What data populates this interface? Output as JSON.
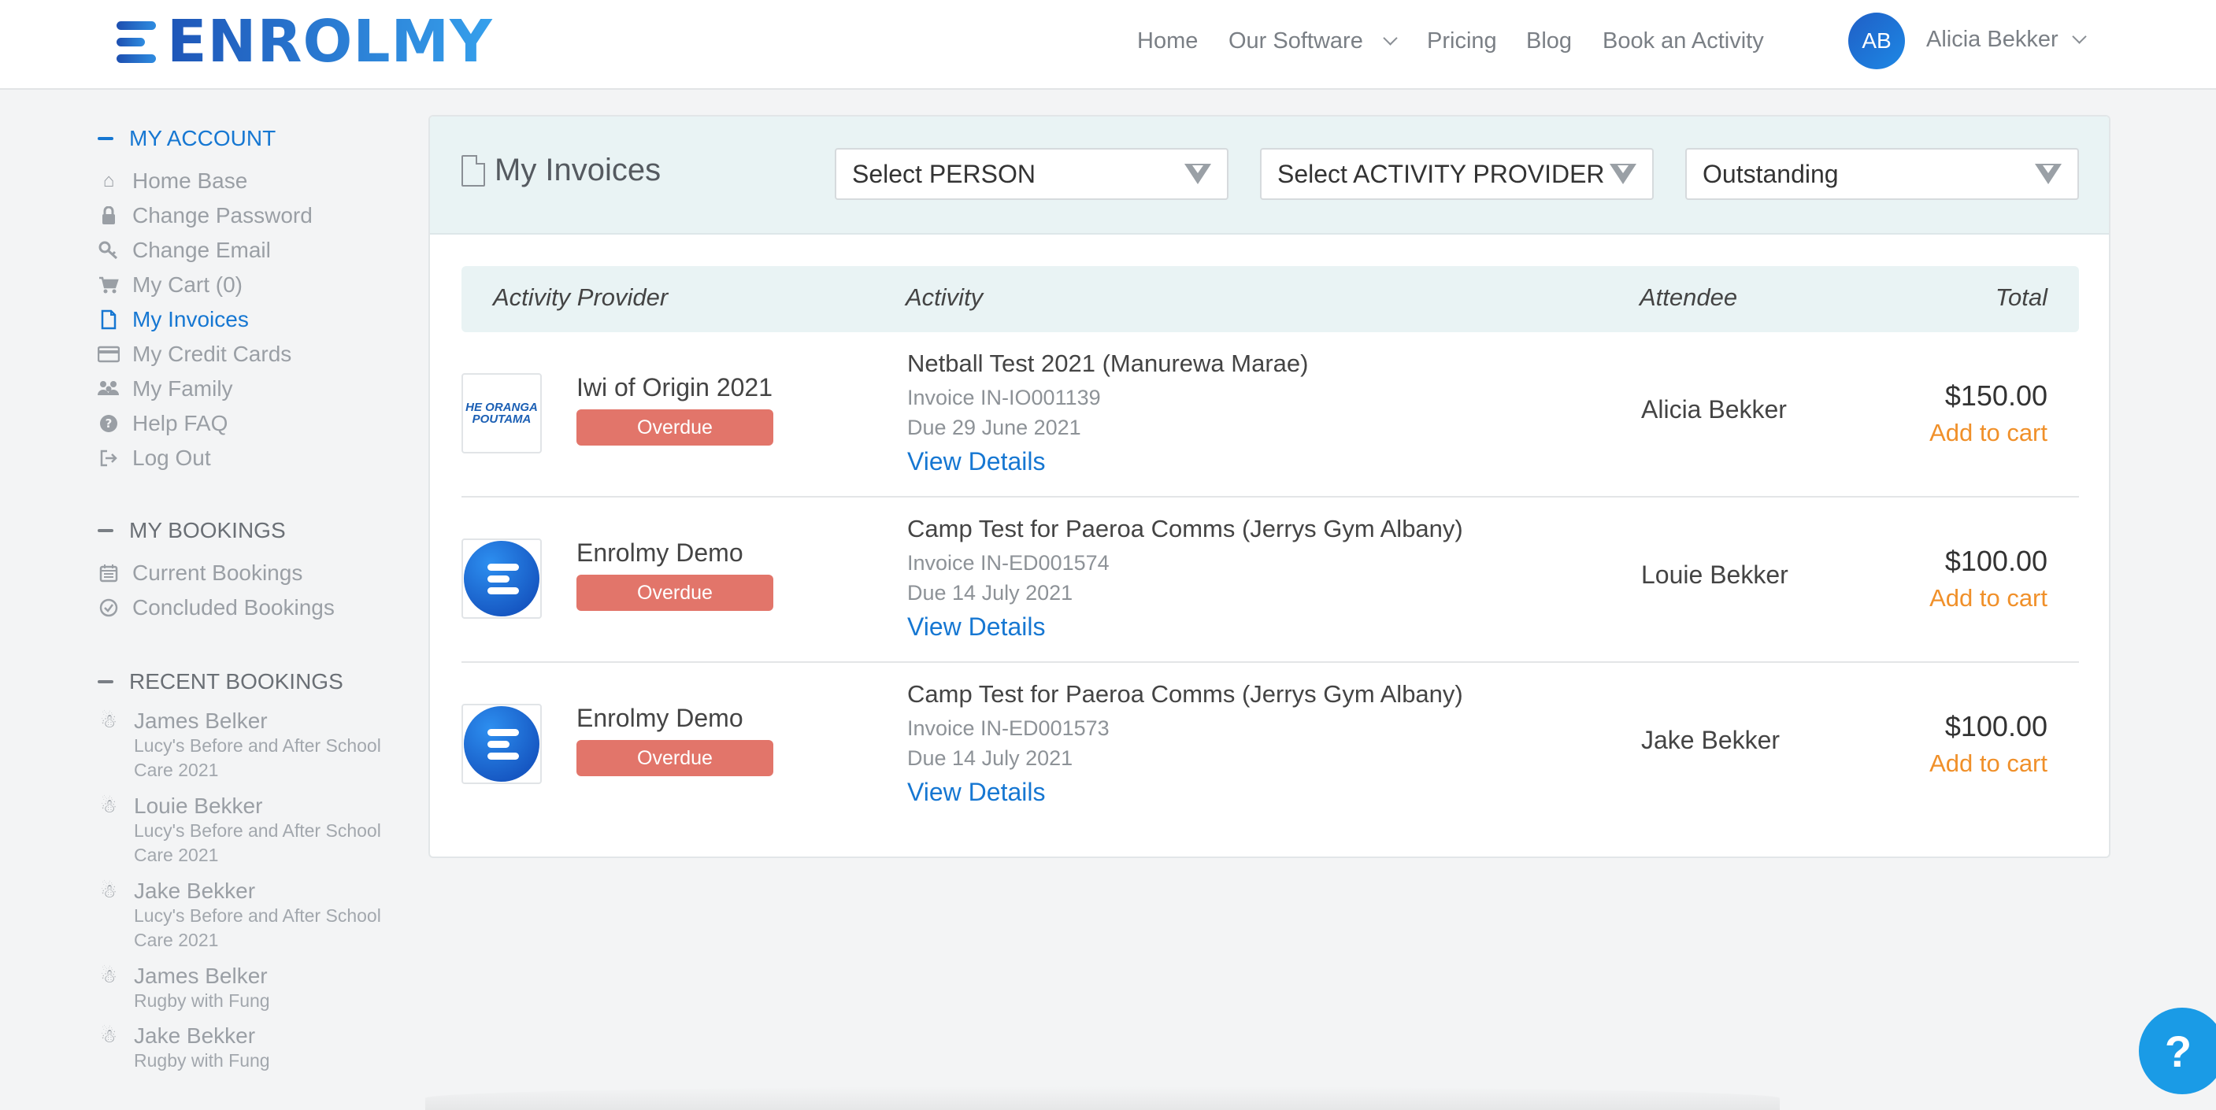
{
  "brand": {
    "logo_text": "ENROLMY"
  },
  "nav": {
    "home": "Home",
    "software": "Our Software",
    "pricing": "Pricing",
    "blog": "Blog",
    "book": "Book an Activity"
  },
  "user": {
    "initials": "AB",
    "name": "Alicia Bekker"
  },
  "sidebar": {
    "account_title": "MY ACCOUNT",
    "account_items": [
      {
        "label": "Home Base",
        "icon": "home-icon"
      },
      {
        "label": "Change Password",
        "icon": "lock-icon"
      },
      {
        "label": "Change Email",
        "icon": "key-icon"
      },
      {
        "label": "My Cart (0)",
        "icon": "cart-icon"
      },
      {
        "label": "My Invoices",
        "icon": "document-icon"
      },
      {
        "label": "My Credit Cards",
        "icon": "credit-card-icon"
      },
      {
        "label": "My Family",
        "icon": "family-icon"
      },
      {
        "label": "Help FAQ",
        "icon": "question-circle-icon"
      },
      {
        "label": "Log Out",
        "icon": "logout-icon"
      }
    ],
    "bookings_title": "MY BOOKINGS",
    "bookings_items": [
      {
        "label": "Current Bookings",
        "icon": "calendar-icon"
      },
      {
        "label": "Concluded Bookings",
        "icon": "check-circle-icon"
      }
    ],
    "recent_title": "RECENT BOOKINGS",
    "recent_items": [
      {
        "name": "James Belker",
        "activity": "Lucy's Before and After School Care 2021"
      },
      {
        "name": "Louie Bekker",
        "activity": "Lucy's Before and After School Care 2021"
      },
      {
        "name": "Jake Bekker",
        "activity": "Lucy's Before and After School Care 2021"
      },
      {
        "name": "James Belker",
        "activity": "Rugby with Fung"
      },
      {
        "name": "Jake Bekker",
        "activity": "Rugby with Fung"
      }
    ]
  },
  "invoices": {
    "title": "My Invoices",
    "filters": {
      "person": "Select PERSON",
      "provider": "Select ACTIVITY PROVIDER",
      "status": "Outstanding"
    },
    "columns": {
      "provider": "Activity Provider",
      "activity": "Activity",
      "attendee": "Attendee",
      "total": "Total"
    },
    "rows": [
      {
        "provider": "Iwi of Origin 2021",
        "logo_text": "HE ORANGA POUTAMA",
        "badge": "Overdue",
        "activity": "Netball Test 2021 (Manurewa Marae)",
        "invoice": "Invoice IN-IO001139",
        "due": "Due 29 June 2021",
        "view": "View Details",
        "attendee": "Alicia Bekker",
        "amount": "$150.00",
        "cart": "Add to cart"
      },
      {
        "provider": "Enrolmy Demo",
        "badge": "Overdue",
        "activity": "Camp Test for Paeroa Comms (Jerrys Gym Albany)",
        "invoice": "Invoice IN-ED001574",
        "due": "Due 14 July 2021",
        "view": "View Details",
        "attendee": "Louie Bekker",
        "amount": "$100.00",
        "cart": "Add to cart"
      },
      {
        "provider": "Enrolmy Demo",
        "badge": "Overdue",
        "activity": "Camp Test for Paeroa Comms (Jerrys Gym Albany)",
        "invoice": "Invoice IN-ED001573",
        "due": "Due 14 July 2021",
        "view": "View Details",
        "attendee": "Jake Bekker",
        "amount": "$100.00",
        "cart": "Add to cart"
      }
    ]
  },
  "help": {
    "label": "?"
  },
  "colors": {
    "accent": "#1677d2",
    "overdue": "#e2756a",
    "cart": "#f0902a",
    "panel_header": "#e9f3f4"
  }
}
